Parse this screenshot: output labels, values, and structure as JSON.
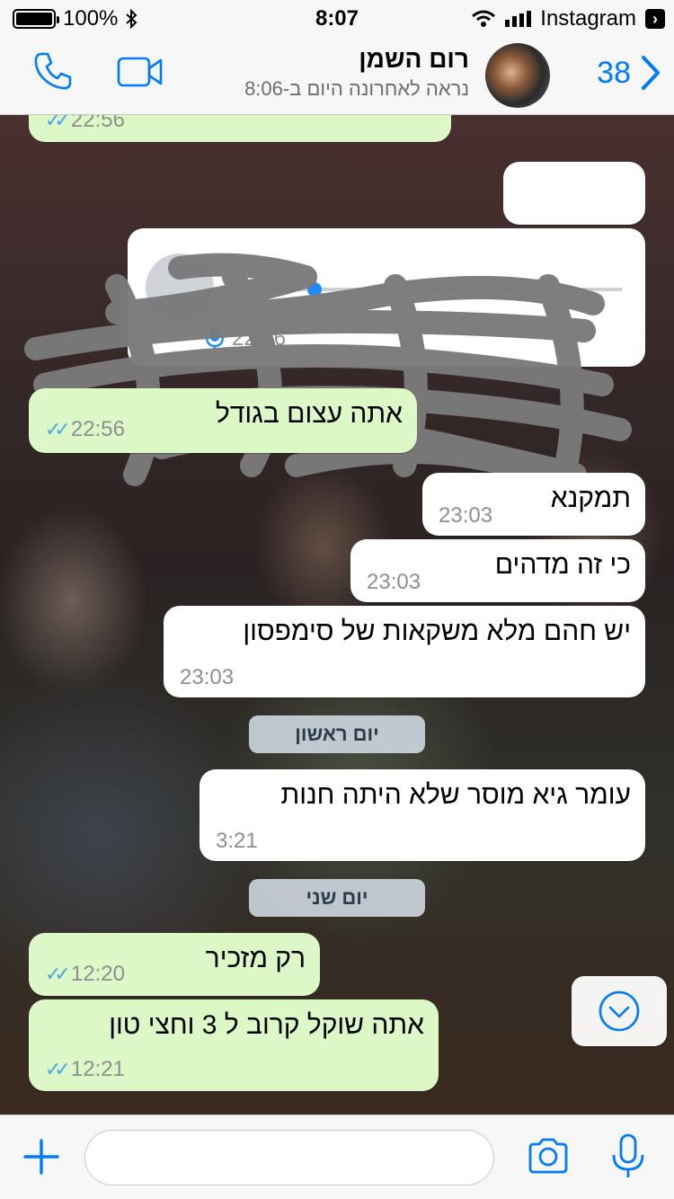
{
  "status_bar": {
    "battery": "100%",
    "time": "8:07",
    "back_app": "Instagram"
  },
  "header": {
    "back_count": "38",
    "contact_name": "רום השמן",
    "contact_status": "נראה לאחרונה היום ב-8:06"
  },
  "messages": {
    "m0": {
      "time": "22:56"
    },
    "voice": {
      "time": "22:56"
    },
    "m1": {
      "text": "אתה עצום בגודל",
      "time": "22:56"
    },
    "m2": {
      "text": "תמקנא",
      "time": "23:03"
    },
    "m3": {
      "text": "כי זה מדהים",
      "time": "23:03"
    },
    "m4": {
      "text": "יש חהם מלא משקאות של סימפסון",
      "time": "23:03"
    },
    "day1": "יום ראשון",
    "m5": {
      "text": "עומר גיא מוסר שלא היתה חנות",
      "time": "3:21"
    },
    "day2": "יום שני",
    "m6": {
      "text": "רק מזכיר",
      "time": "12:20"
    },
    "m7": {
      "text": "אתה שוקל קרוב ל 3 וחצי טון",
      "time": "12:21"
    }
  },
  "input": {
    "placeholder": ""
  },
  "colors": {
    "accent": "#007aff",
    "outgoing_bubble": "#dcf8c6",
    "incoming_bubble": "#ffffff",
    "read_ticks": "#4aa7e8"
  },
  "icons": [
    "phone-icon",
    "video-camera-icon",
    "chevron-right-icon",
    "microphone-icon",
    "double-check-icon",
    "chevron-down-circle-icon",
    "plus-icon",
    "camera-icon",
    "wifi-icon",
    "bluetooth-icon"
  ]
}
